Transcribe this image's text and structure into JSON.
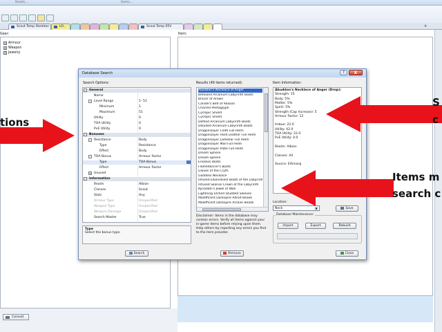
{
  "window": {
    "title_fragments": [
      "Realm...",
      "Items..."
    ]
  },
  "tabs": [
    {
      "label": "Scout Temp Skeleton"
    },
    {
      "label": "LO..."
    },
    {
      "label": "Scout Temp 05V"
    }
  ],
  "left_panel": {
    "label": "Gear:",
    "tree": [
      {
        "toggle": "+",
        "label": "Armour"
      },
      {
        "toggle": "+",
        "label": "Weapon"
      },
      {
        "toggle": "+",
        "label": "Jewelry"
      }
    ]
  },
  "right_panel": {
    "label": "Item:"
  },
  "status_bar": {
    "consult_label": "Consult"
  },
  "dialog": {
    "title": "Database Search",
    "help_label": "?",
    "close_label": "X",
    "search_options_label": "Search Options:",
    "results_label": "Results (49 items returned):",
    "info_label": "Item Information:",
    "properties": [
      {
        "kind": "cat",
        "toggle": "-",
        "name": "General",
        "value": ""
      },
      {
        "kind": "row",
        "toggle": "",
        "name": "Name",
        "value": ""
      },
      {
        "kind": "row",
        "toggle": "-",
        "name": "Level Range",
        "value": "1- 51"
      },
      {
        "kind": "sub",
        "toggle": "",
        "name": "Minimum",
        "value": "1"
      },
      {
        "kind": "sub",
        "toggle": "",
        "name": "Maximum",
        "value": "51"
      },
      {
        "kind": "row",
        "toggle": "",
        "name": "Utility",
        "value": "0"
      },
      {
        "kind": "row",
        "toggle": "",
        "name": "TOA Utility",
        "value": "0"
      },
      {
        "kind": "row",
        "toggle": "",
        "name": "PvE Utility",
        "value": "0"
      },
      {
        "kind": "cat",
        "toggle": "-",
        "name": "Bonuses",
        "value": ""
      },
      {
        "kind": "row",
        "toggle": "-",
        "name": "Resistance",
        "value": "Body"
      },
      {
        "kind": "sub",
        "toggle": "",
        "name": "Type",
        "value": "Resistance"
      },
      {
        "kind": "sub",
        "toggle": "",
        "name": "Effect",
        "value": "Body"
      },
      {
        "kind": "row",
        "toggle": "-",
        "name": "TOA Bonus",
        "value": "Armour Factor"
      },
      {
        "kind": "sel",
        "toggle": "",
        "name": "Type",
        "value": "TOA Bonus"
      },
      {
        "kind": "sub",
        "toggle": "",
        "name": "Effect",
        "value": "Armour Factor"
      },
      {
        "kind": "row",
        "toggle": "+",
        "name": "Unused",
        "value": ""
      },
      {
        "kind": "cat",
        "toggle": "-",
        "name": "Information",
        "value": ""
      },
      {
        "kind": "row",
        "toggle": "",
        "name": "Realm",
        "value": "Albion"
      },
      {
        "kind": "row",
        "toggle": "",
        "name": "Classes",
        "value": "Scout"
      },
      {
        "kind": "row",
        "toggle": "",
        "name": "Slots",
        "value": "Any"
      },
      {
        "kind": "dim",
        "toggle": "",
        "name": "Armour Type",
        "value": "Unspecified"
      },
      {
        "kind": "dim",
        "toggle": "",
        "name": "Weapon Type",
        "value": "Unspecified"
      },
      {
        "kind": "dim",
        "toggle": "",
        "name": "Weapon Damage",
        "value": "Unspecified"
      },
      {
        "kind": "row",
        "toggle": "",
        "name": "Search Master",
        "value": "True"
      }
    ],
    "description": {
      "title": "Type",
      "text": "Select the bonus type."
    },
    "results": [
      "Abaddon's Necklace of Anger",
      "Befouled Arcanium Labyrinth Boots",
      "Bracer of Arawn",
      "Candle's Belt of Reason",
      "Charred Pentaglyph",
      "Cyclopic Shield",
      "Cyclopic Shield",
      "Defiled Arcanium Labyrinth Boots",
      "Deluded Arcanium Labyrinth Boots",
      "Dragonslayer Cloth Full Helm",
      "Dragonslayer Hard Leather Full Helm",
      "Dragonslayer Lamellar Full Helm",
      "Dragonslayer Mail Full Helm",
      "Dragonslayer Plate Full Helm",
      "Dream Sphere",
      "Dream Sphere",
      "Ensalios Boots",
      "Flamedancer's Boots",
      "Gloves of the Cryth",
      "Goddess Necklace",
      "Infused Elkonidsest Boots of the Labyrinth",
      "Infused Skarios Crown of the Labyrinth",
      "Kynadahi's Jewel of Woe",
      "Lightning Etched Studded Sleeves",
      "Malefficent Darkspire Adroit Beads",
      "Malefficent Darkspire Arcane Beads"
    ],
    "disclaimer": "Disclaimer: Items in the database may contain errors. Verify all items against your in-game items before relying upon them. Help others by reporting any errors you find to the item provider.",
    "info_lines": [
      {
        "bold": true,
        "text": "Abuddon's Necklace of Anger (Drop):"
      },
      {
        "bold": false,
        "text": "Strength: 15"
      },
      {
        "bold": false,
        "text": "Body: 5%"
      },
      {
        "bold": false,
        "text": "Matter: 5%"
      },
      {
        "bold": false,
        "text": "Spirit: 5%"
      },
      {
        "bold": false,
        "text": "Strength (Cap Increase): 5"
      },
      {
        "bold": false,
        "text": "Armour Factor: 12"
      },
      {
        "bold": false,
        "text": ""
      },
      {
        "bold": false,
        "text": "Imbue: 22.0"
      },
      {
        "bold": false,
        "text": "Utility: 42.0"
      },
      {
        "bold": false,
        "text": "TOA Utility: 22.0"
      },
      {
        "bold": false,
        "text": "PvE Utility: 0.0"
      },
      {
        "bold": false,
        "text": ""
      },
      {
        "bold": false,
        "text": "Realm: Albion"
      },
      {
        "bold": false,
        "text": ""
      },
      {
        "bold": false,
        "text": "Classes: All"
      },
      {
        "bold": false,
        "text": ""
      },
      {
        "bold": false,
        "text": "Source: Ethinarg"
      }
    ],
    "location_label": "Location:",
    "location_value": "Neck",
    "save_label": "Save",
    "maintenance_label": "Database Maintenance:",
    "import_label": "Import",
    "export_label": "Export",
    "rebuild_label": "Rebuild",
    "search_label": "Search",
    "remove_label": "Remove",
    "close_button_label": "Close"
  },
  "annotations": {
    "left_text": "tions",
    "top_right_letter": "S",
    "top_right_letter2": "c",
    "right_line1": "Items m",
    "right_line2": "search c",
    "arrow_color": "#e8121b"
  }
}
